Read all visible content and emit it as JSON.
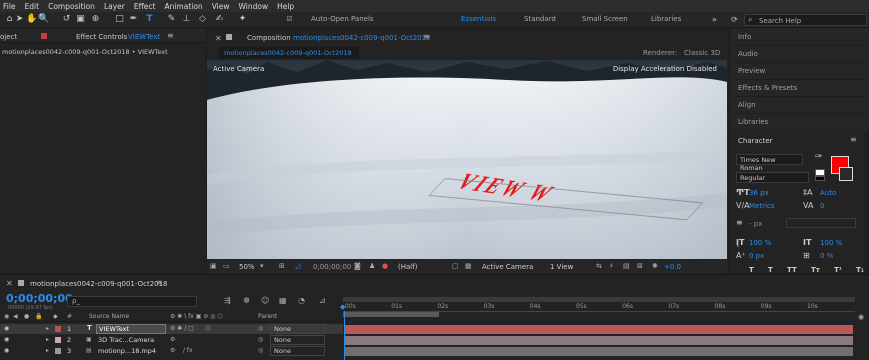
{
  "menu": [
    "File",
    "Edit",
    "Composition",
    "Layer",
    "Effect",
    "Animation",
    "View",
    "Window",
    "Help"
  ],
  "toolbar": {
    "auto_open_label": "Auto-Open Panels",
    "workspaces": [
      "Essentials",
      "Standard",
      "Small Screen",
      "Libraries"
    ],
    "search_placeholder": "Search Help"
  },
  "left_panel": {
    "project_tab": "oject",
    "effect_controls_label": "Effect Controls",
    "effect_controls_layer": "VIEWText",
    "breadcrumb": "motionplaces0042-c009-q001-Oct2018 • VIEWText"
  },
  "composition": {
    "tab_label": "Composition",
    "tab_name": "motionplaces0042-c009-q001-Oct2018",
    "subtab": "motionplaces0042-c009-q001-Oct2018",
    "renderer_label": "Renderer:",
    "renderer_value": "Classic 3D",
    "active_camera": "Active Camera",
    "display_accel": "Display Acceleration Disabled",
    "text_layer": "VIEW W",
    "footer": {
      "zoom": "50%",
      "timecode": "0;00;00;00",
      "resolution": "(Half)",
      "view": "Active Camera",
      "views": "1 View",
      "exposure": "+0.0"
    }
  },
  "right_panel": {
    "sections": [
      "Info",
      "Audio",
      "Preview",
      "Effects & Presets",
      "Align",
      "Libraries"
    ],
    "character": {
      "title": "Character",
      "font": "Times New Roman",
      "style": "Regular",
      "size": "36 px",
      "leading": "Auto",
      "kerning": "Metrics",
      "tracking": "0",
      "stroke": "- px",
      "vscale": "100 %",
      "hscale": "100 %",
      "baseline": "0 px",
      "tsume": "0 %",
      "fill_color": "#ff0000"
    }
  },
  "timeline": {
    "comp_name": "motionplaces0042-c009-q001-Oct2018",
    "timecode": "0;00;00;00",
    "frame_info": "00000 (29.97 fps)",
    "search_placeholder": "ρ_",
    "headers": {
      "num": "#",
      "source": "Source Name",
      "parent": "Parent"
    },
    "ruler": [
      "00s",
      "01s",
      "02s",
      "03s",
      "04s",
      "05s",
      "06s",
      "07s",
      "08s",
      "09s",
      "10s"
    ],
    "layers": [
      {
        "num": "1",
        "type": "T",
        "name": "VIEWText",
        "parent": "None",
        "label": "#c05050",
        "bar": "#b85a5a"
      },
      {
        "num": "2",
        "type": "",
        "name": "3D Trac...Camera",
        "parent": "None",
        "label": "#d6a2b0",
        "bar": "#8a7a80"
      },
      {
        "num": "3",
        "type": "",
        "name": "motionp...18.mp4",
        "parent": "None",
        "label": "#9a9a9a",
        "bar": "#6f6f6f"
      }
    ]
  }
}
